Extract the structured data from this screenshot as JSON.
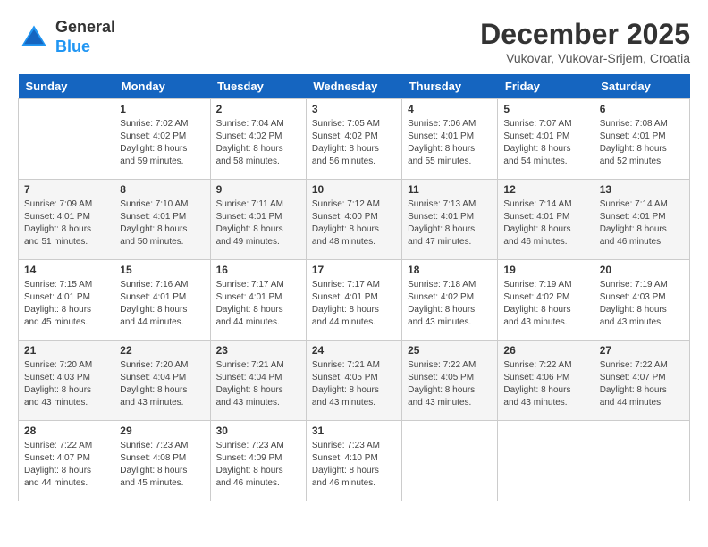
{
  "header": {
    "logo": {
      "general": "General",
      "blue": "Blue"
    },
    "title": "December 2025",
    "location": "Vukovar, Vukovar-Srijem, Croatia"
  },
  "days_of_week": [
    "Sunday",
    "Monday",
    "Tuesday",
    "Wednesday",
    "Thursday",
    "Friday",
    "Saturday"
  ],
  "weeks": [
    [
      {
        "day": "",
        "sunrise": "",
        "sunset": "",
        "daylight": ""
      },
      {
        "day": "1",
        "sunrise": "Sunrise: 7:02 AM",
        "sunset": "Sunset: 4:02 PM",
        "daylight": "Daylight: 8 hours and 59 minutes."
      },
      {
        "day": "2",
        "sunrise": "Sunrise: 7:04 AM",
        "sunset": "Sunset: 4:02 PM",
        "daylight": "Daylight: 8 hours and 58 minutes."
      },
      {
        "day": "3",
        "sunrise": "Sunrise: 7:05 AM",
        "sunset": "Sunset: 4:02 PM",
        "daylight": "Daylight: 8 hours and 56 minutes."
      },
      {
        "day": "4",
        "sunrise": "Sunrise: 7:06 AM",
        "sunset": "Sunset: 4:01 PM",
        "daylight": "Daylight: 8 hours and 55 minutes."
      },
      {
        "day": "5",
        "sunrise": "Sunrise: 7:07 AM",
        "sunset": "Sunset: 4:01 PM",
        "daylight": "Daylight: 8 hours and 54 minutes."
      },
      {
        "day": "6",
        "sunrise": "Sunrise: 7:08 AM",
        "sunset": "Sunset: 4:01 PM",
        "daylight": "Daylight: 8 hours and 52 minutes."
      }
    ],
    [
      {
        "day": "7",
        "sunrise": "Sunrise: 7:09 AM",
        "sunset": "Sunset: 4:01 PM",
        "daylight": "Daylight: 8 hours and 51 minutes."
      },
      {
        "day": "8",
        "sunrise": "Sunrise: 7:10 AM",
        "sunset": "Sunset: 4:01 PM",
        "daylight": "Daylight: 8 hours and 50 minutes."
      },
      {
        "day": "9",
        "sunrise": "Sunrise: 7:11 AM",
        "sunset": "Sunset: 4:01 PM",
        "daylight": "Daylight: 8 hours and 49 minutes."
      },
      {
        "day": "10",
        "sunrise": "Sunrise: 7:12 AM",
        "sunset": "Sunset: 4:00 PM",
        "daylight": "Daylight: 8 hours and 48 minutes."
      },
      {
        "day": "11",
        "sunrise": "Sunrise: 7:13 AM",
        "sunset": "Sunset: 4:01 PM",
        "daylight": "Daylight: 8 hours and 47 minutes."
      },
      {
        "day": "12",
        "sunrise": "Sunrise: 7:14 AM",
        "sunset": "Sunset: 4:01 PM",
        "daylight": "Daylight: 8 hours and 46 minutes."
      },
      {
        "day": "13",
        "sunrise": "Sunrise: 7:14 AM",
        "sunset": "Sunset: 4:01 PM",
        "daylight": "Daylight: 8 hours and 46 minutes."
      }
    ],
    [
      {
        "day": "14",
        "sunrise": "Sunrise: 7:15 AM",
        "sunset": "Sunset: 4:01 PM",
        "daylight": "Daylight: 8 hours and 45 minutes."
      },
      {
        "day": "15",
        "sunrise": "Sunrise: 7:16 AM",
        "sunset": "Sunset: 4:01 PM",
        "daylight": "Daylight: 8 hours and 44 minutes."
      },
      {
        "day": "16",
        "sunrise": "Sunrise: 7:17 AM",
        "sunset": "Sunset: 4:01 PM",
        "daylight": "Daylight: 8 hours and 44 minutes."
      },
      {
        "day": "17",
        "sunrise": "Sunrise: 7:17 AM",
        "sunset": "Sunset: 4:01 PM",
        "daylight": "Daylight: 8 hours and 44 minutes."
      },
      {
        "day": "18",
        "sunrise": "Sunrise: 7:18 AM",
        "sunset": "Sunset: 4:02 PM",
        "daylight": "Daylight: 8 hours and 43 minutes."
      },
      {
        "day": "19",
        "sunrise": "Sunrise: 7:19 AM",
        "sunset": "Sunset: 4:02 PM",
        "daylight": "Daylight: 8 hours and 43 minutes."
      },
      {
        "day": "20",
        "sunrise": "Sunrise: 7:19 AM",
        "sunset": "Sunset: 4:03 PM",
        "daylight": "Daylight: 8 hours and 43 minutes."
      }
    ],
    [
      {
        "day": "21",
        "sunrise": "Sunrise: 7:20 AM",
        "sunset": "Sunset: 4:03 PM",
        "daylight": "Daylight: 8 hours and 43 minutes."
      },
      {
        "day": "22",
        "sunrise": "Sunrise: 7:20 AM",
        "sunset": "Sunset: 4:04 PM",
        "daylight": "Daylight: 8 hours and 43 minutes."
      },
      {
        "day": "23",
        "sunrise": "Sunrise: 7:21 AM",
        "sunset": "Sunset: 4:04 PM",
        "daylight": "Daylight: 8 hours and 43 minutes."
      },
      {
        "day": "24",
        "sunrise": "Sunrise: 7:21 AM",
        "sunset": "Sunset: 4:05 PM",
        "daylight": "Daylight: 8 hours and 43 minutes."
      },
      {
        "day": "25",
        "sunrise": "Sunrise: 7:22 AM",
        "sunset": "Sunset: 4:05 PM",
        "daylight": "Daylight: 8 hours and 43 minutes."
      },
      {
        "day": "26",
        "sunrise": "Sunrise: 7:22 AM",
        "sunset": "Sunset: 4:06 PM",
        "daylight": "Daylight: 8 hours and 43 minutes."
      },
      {
        "day": "27",
        "sunrise": "Sunrise: 7:22 AM",
        "sunset": "Sunset: 4:07 PM",
        "daylight": "Daylight: 8 hours and 44 minutes."
      }
    ],
    [
      {
        "day": "28",
        "sunrise": "Sunrise: 7:22 AM",
        "sunset": "Sunset: 4:07 PM",
        "daylight": "Daylight: 8 hours and 44 minutes."
      },
      {
        "day": "29",
        "sunrise": "Sunrise: 7:23 AM",
        "sunset": "Sunset: 4:08 PM",
        "daylight": "Daylight: 8 hours and 45 minutes."
      },
      {
        "day": "30",
        "sunrise": "Sunrise: 7:23 AM",
        "sunset": "Sunset: 4:09 PM",
        "daylight": "Daylight: 8 hours and 46 minutes."
      },
      {
        "day": "31",
        "sunrise": "Sunrise: 7:23 AM",
        "sunset": "Sunset: 4:10 PM",
        "daylight": "Daylight: 8 hours and 46 minutes."
      },
      {
        "day": "",
        "sunrise": "",
        "sunset": "",
        "daylight": ""
      },
      {
        "day": "",
        "sunrise": "",
        "sunset": "",
        "daylight": ""
      },
      {
        "day": "",
        "sunrise": "",
        "sunset": "",
        "daylight": ""
      }
    ]
  ]
}
